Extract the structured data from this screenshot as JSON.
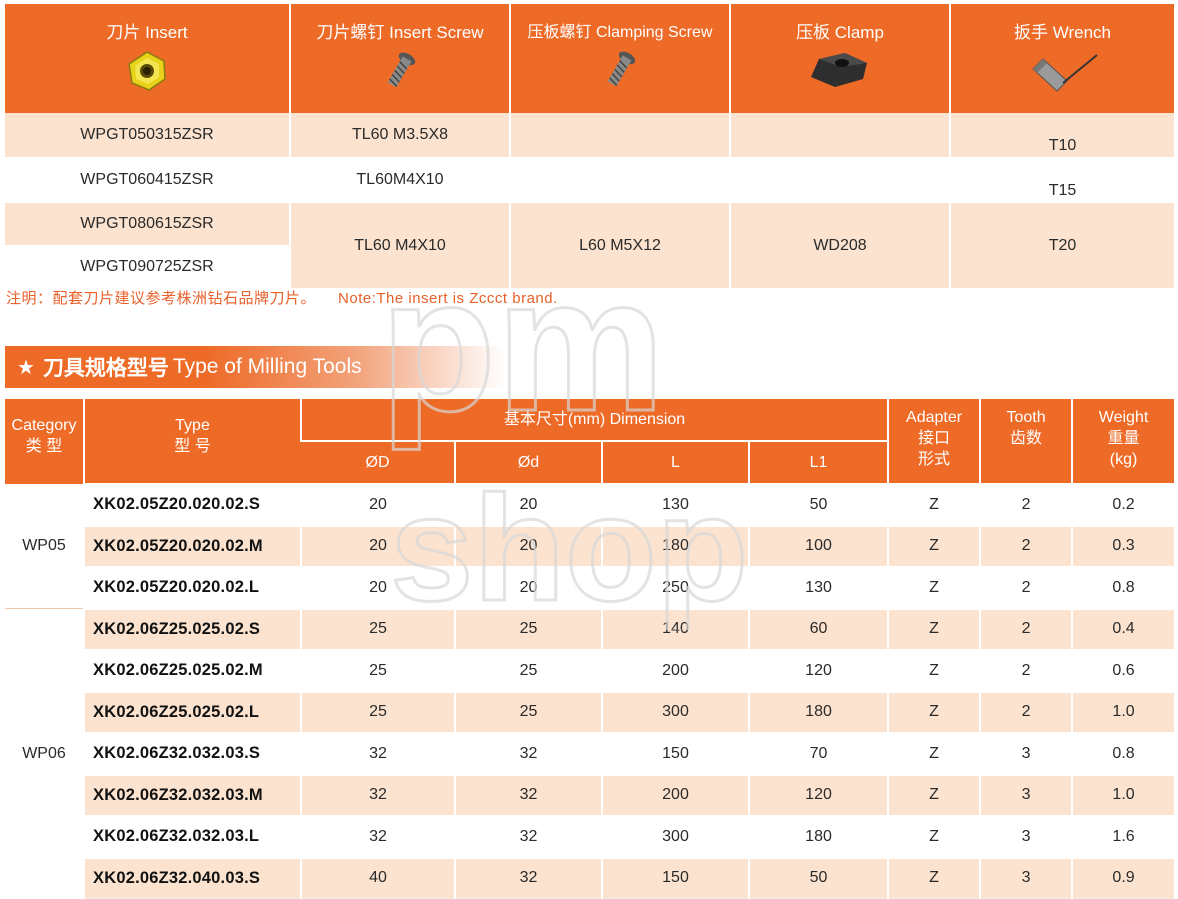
{
  "accessory_table": {
    "headers": [
      {
        "label": "刀片 Insert",
        "icon": "insert-icon"
      },
      {
        "label": "刀片螺钉 Insert Screw",
        "icon": "screw-icon"
      },
      {
        "label": "压板螺钉 Clamping Screw",
        "icon": "screw-icon"
      },
      {
        "label": "压板 Clamp",
        "icon": "clamp-icon"
      },
      {
        "label": "扳手 Wrench",
        "icon": "wrench-icon"
      }
    ],
    "inserts": [
      "WPGT050315ZSR",
      "WPGT060415ZSR",
      "WPGT080615ZSR",
      "WPGT090725ZSR"
    ],
    "insert_screws": [
      "TL60 M3.5X8",
      "TL60M4X10",
      "TL60 M4X10"
    ],
    "clamping_screw": "L60 M5X12",
    "clamp": "WD208",
    "wrenches": [
      "T10",
      "T15",
      "T20"
    ]
  },
  "note": {
    "cn": "注明：配套刀片建议参考株洲钻石品牌刀片。",
    "en": "Note:The insert is Zccct brand."
  },
  "section": {
    "star": "★",
    "title_cn": "刀具规格型号",
    "title_en": "Type of Milling Tools"
  },
  "tools_table": {
    "headers": {
      "category": [
        "Category",
        "类 型"
      ],
      "type": [
        "Type",
        "型 号"
      ],
      "dimension": "基本尺寸(mm) Dimension",
      "D": "ØD",
      "d": "Ød",
      "L": "L",
      "L1": "L1",
      "adapter": [
        "Adapter",
        "接口",
        "形式"
      ],
      "tooth": [
        "Tooth",
        "齿数"
      ],
      "weight": [
        "Weight",
        "重量",
        "(kg)"
      ]
    },
    "groups": [
      {
        "category": "WP05",
        "rows": [
          {
            "type": "XK02.05Z20.020.02.S",
            "D": "20",
            "d": "20",
            "L": "130",
            "L1": "50",
            "adapter": "Z",
            "tooth": "2",
            "weight": "0.2"
          },
          {
            "type": "XK02.05Z20.020.02.M",
            "D": "20",
            "d": "20",
            "L": "180",
            "L1": "100",
            "adapter": "Z",
            "tooth": "2",
            "weight": "0.3"
          },
          {
            "type": "XK02.05Z20.020.02.L",
            "D": "20",
            "d": "20",
            "L": "250",
            "L1": "130",
            "adapter": "Z",
            "tooth": "2",
            "weight": "0.8"
          }
        ]
      },
      {
        "category": "WP06",
        "rows": [
          {
            "type": "XK02.06Z25.025.02.S",
            "D": "25",
            "d": "25",
            "L": "140",
            "L1": "60",
            "adapter": "Z",
            "tooth": "2",
            "weight": "0.4"
          },
          {
            "type": "XK02.06Z25.025.02.M",
            "D": "25",
            "d": "25",
            "L": "200",
            "L1": "120",
            "adapter": "Z",
            "tooth": "2",
            "weight": "0.6"
          },
          {
            "type": "XK02.06Z25.025.02.L",
            "D": "25",
            "d": "25",
            "L": "300",
            "L1": "180",
            "adapter": "Z",
            "tooth": "2",
            "weight": "1.0"
          },
          {
            "type": "XK02.06Z32.032.03.S",
            "D": "32",
            "d": "32",
            "L": "150",
            "L1": "70",
            "adapter": "Z",
            "tooth": "3",
            "weight": "0.8"
          },
          {
            "type": "XK02.06Z32.032.03.M",
            "D": "32",
            "d": "32",
            "L": "200",
            "L1": "120",
            "adapter": "Z",
            "tooth": "3",
            "weight": "1.0"
          },
          {
            "type": "XK02.06Z32.032.03.L",
            "D": "32",
            "d": "32",
            "L": "300",
            "L1": "180",
            "adapter": "Z",
            "tooth": "3",
            "weight": "1.6"
          },
          {
            "type": "XK02.06Z32.040.03.S",
            "D": "40",
            "d": "32",
            "L": "150",
            "L1": "50",
            "adapter": "Z",
            "tooth": "3",
            "weight": "0.9"
          }
        ]
      }
    ]
  },
  "watermark": {
    "line1": "pm",
    "line2": "shop"
  },
  "colors": {
    "accent": "#ee6a27",
    "row_shade": "#fbe3cf",
    "note": "#e8602a"
  }
}
